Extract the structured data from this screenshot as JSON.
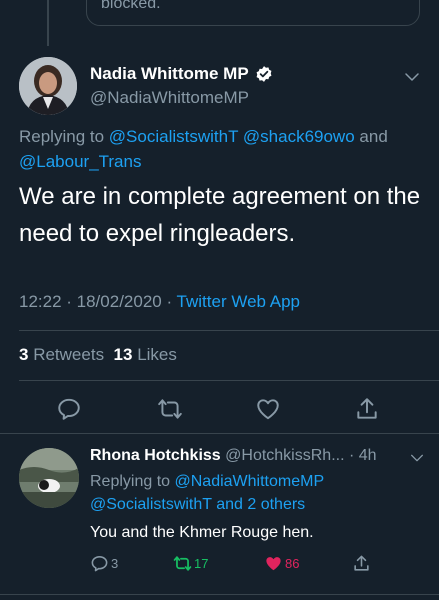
{
  "previous": {
    "partial_text": "blocked."
  },
  "tweet": {
    "name": "Nadia Whittome MP",
    "handle": "@NadiaWhittomeMP",
    "replying_prefix": "Replying to",
    "reply_mention_1": "@SocialistswithT",
    "reply_mention_2": "@shack69owo",
    "reply_and": "and",
    "reply_mention_3": "@Labour_Trans",
    "text": "We are in complete agreement on the need to expel ringleaders.",
    "timestamp": "12:22 · 18/02/2020 ·",
    "client": "Twitter Web App",
    "retweets_count": "3",
    "retweets_label": "Retweets",
    "likes_count": "13",
    "likes_label": "Likes"
  },
  "reply": {
    "name": "Rhona Hotchkiss",
    "handle": "@HotchkissRh...",
    "time": "· 4h",
    "replying_prefix": "Replying to",
    "mention_1": "@NadiaWhittomeMP",
    "mention_2": "@SocialistswithT",
    "and_others": "and 2 others",
    "text": "You and the Khmer Rouge hen.",
    "reply_count": "3",
    "retweet_count": "17",
    "like_count": "86"
  },
  "icons": {
    "verified": "verified-badge-icon",
    "chevron": "chevron-down-icon",
    "reply": "reply-icon",
    "retweet": "retweet-icon",
    "like": "heart-icon",
    "share": "share-icon"
  },
  "colors": {
    "background": "#15202b",
    "link": "#1da1f2",
    "muted": "#8899a6",
    "retweet_active": "#17bf63",
    "like_active": "#e0245e"
  }
}
